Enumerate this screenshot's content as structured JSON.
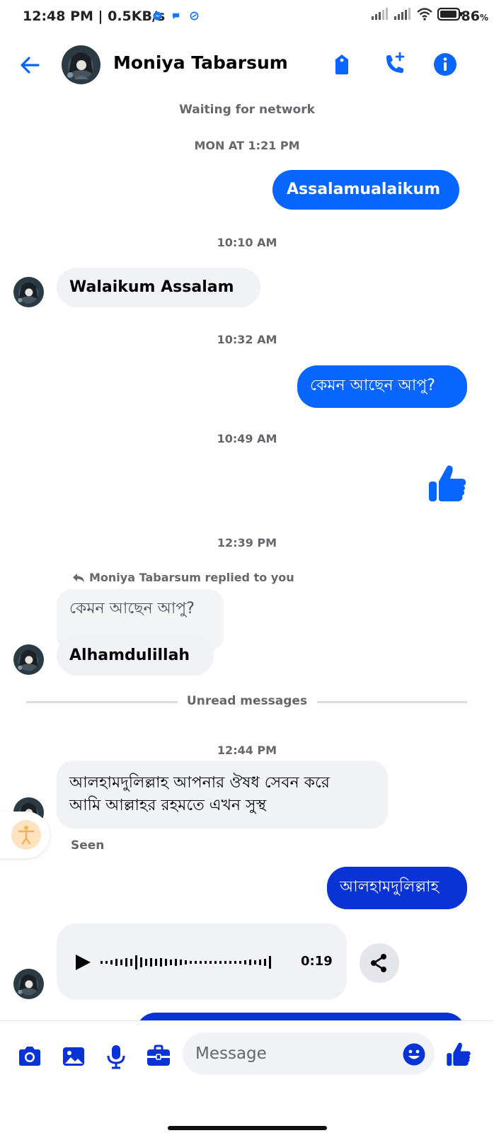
{
  "status_bar": {
    "time_speed": "12:48 PM | 0.5KB/s",
    "battery": "86",
    "battery_unit": "%"
  },
  "header": {
    "contact_name": "Moniya Tabarsum"
  },
  "network_status": "Waiting for network",
  "colors": {
    "accent": "#0866ff",
    "accent_dark": "#0a33d6",
    "incoming_bubble": "#f0f2f5",
    "muted_text": "#65676b"
  },
  "messages": {
    "ts1": "MON AT 1:21 PM",
    "m1": "Assalamualaikum",
    "ts2": "10:10 AM",
    "m2": "Walaikum Assalam",
    "ts3": "10:32 AM",
    "m3": "কেমন আছেন আপু?",
    "ts4": "10:49 AM",
    "ts5": "12:39 PM",
    "replied_label": "Moniya Tabarsum replied to you",
    "quoted": "কেমন আছেন আপু?",
    "m5": "Alhamdulillah",
    "unread": "Unread messages",
    "ts6": "12:44 PM",
    "m6_line1": "আলহামদুলিল্লাহ আপনার ঔষধ সেবন করে",
    "m6_line2": "আমি আল্লাহর রহমতে এখন সুস্থ",
    "seen": "Seen",
    "m7": "আলহামদুলিল্লাহ",
    "voice_duration": "0:19"
  },
  "composer": {
    "placeholder": "Message"
  },
  "icons": [
    "back-arrow-icon",
    "tag-icon",
    "add-call-icon",
    "info-icon",
    "thumbs-up-icon",
    "reply-icon",
    "accessibility-icon",
    "play-icon",
    "share-icon",
    "camera-icon",
    "gallery-icon",
    "microphone-icon",
    "briefcase-icon",
    "emoji-icon"
  ]
}
